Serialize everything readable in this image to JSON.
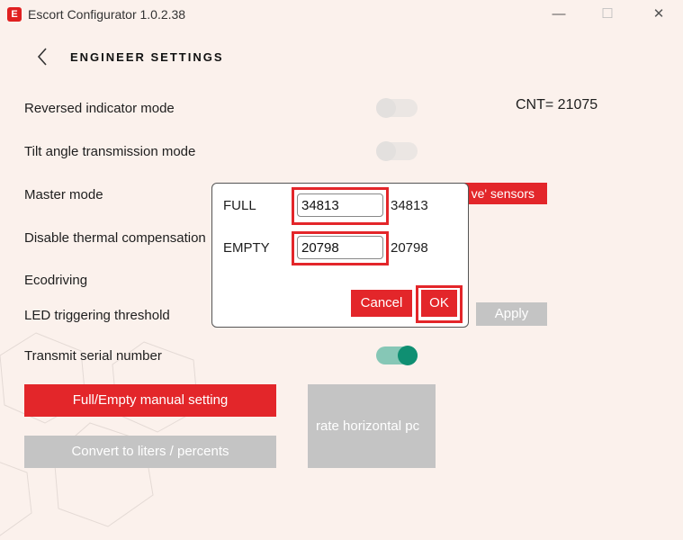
{
  "window": {
    "title": "Escort Configurator 1.0.2.38",
    "logo_text": "E",
    "controls": {
      "minimize": "—",
      "maximize": "☐",
      "close": "✕"
    }
  },
  "header": {
    "title": "Engineer settings",
    "back_icon": "chevron-left-icon"
  },
  "settings": {
    "reversed_indicator": {
      "label": "Reversed indicator mode",
      "on": false
    },
    "tilt_angle": {
      "label": "Tilt angle transmission mode",
      "on": false
    },
    "master_mode": {
      "label": "Master mode",
      "slave_button": "ve' sensors"
    },
    "thermal": {
      "label": "Disable thermal compensation"
    },
    "ecodriving": {
      "label": "Ecodriving"
    },
    "led_threshold": {
      "label": "LED triggering threshold",
      "apply": "Apply"
    },
    "serial": {
      "label": "Transmit serial number",
      "on": true
    }
  },
  "cnt": "CNT= 21075",
  "buttons": {
    "full_empty": "Full/Empty manual setting",
    "convert": "Convert to liters / percents",
    "calibrate": "rate horizontal pc"
  },
  "dialog": {
    "full_label": "FULL",
    "full_input": "34813",
    "full_value": "34813",
    "empty_label": "EMPTY",
    "empty_input": "20798",
    "empty_value": "20798",
    "cancel": "Cancel",
    "ok": "OK"
  },
  "colors": {
    "accent_red": "#e3262a",
    "toggle_on": "#0f8f72",
    "background": "#fbf1ec"
  }
}
